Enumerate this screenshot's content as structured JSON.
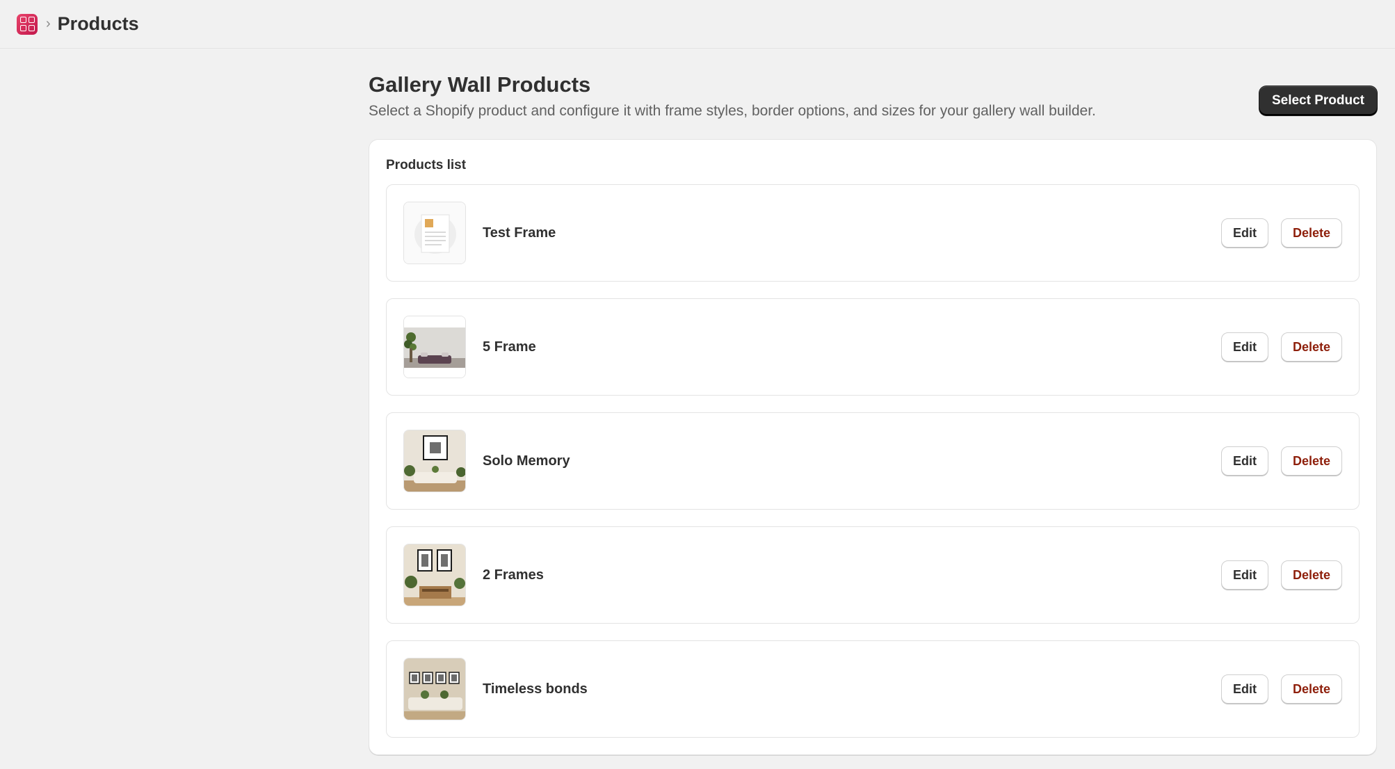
{
  "topbar": {
    "breadcrumb_sep": "›",
    "title": "Products",
    "app_icon": "app-grid-icon"
  },
  "header": {
    "title": "Gallery Wall Products",
    "subtitle": "Select a Shopify product and configure it with frame styles, border options, and sizes for your gallery wall builder.",
    "select_product_label": "Select Product"
  },
  "products_card": {
    "title": "Products list",
    "edit_label": "Edit",
    "delete_label": "Delete",
    "items": [
      {
        "name": "Test Frame"
      },
      {
        "name": "5 Frame"
      },
      {
        "name": "Solo Memory"
      },
      {
        "name": "2 Frames"
      },
      {
        "name": "Timeless bonds"
      }
    ]
  },
  "colors": {
    "primary_button": "#303030",
    "delete_text": "#8e1f0b",
    "app_icon": "#d92c5c",
    "background": "#f1f1f1"
  }
}
